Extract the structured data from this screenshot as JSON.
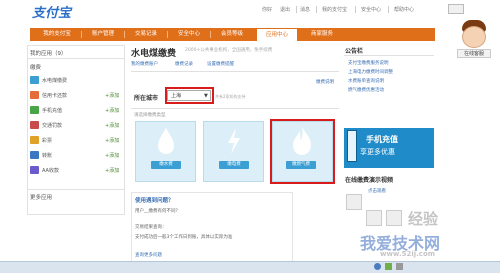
{
  "header": {
    "logo": "支付宝",
    "top_links": [
      "你好",
      "退出",
      "消息",
      "我的支付宝",
      "安全中心",
      "帮助中心"
    ],
    "nav": [
      "我的支付宝",
      "账户管理",
      "交易记录",
      "安全中心",
      "会员等级",
      "应用中心",
      "商家服务"
    ]
  },
  "assistant": {
    "label": "在线客服"
  },
  "sidebar": {
    "my_apps": "我的应用（9）",
    "section": "缴费",
    "items": [
      {
        "label": "水电煤缴费",
        "add": ""
      },
      {
        "label": "信用卡还款",
        "add": "+添加"
      },
      {
        "label": "手机充值",
        "add": "+添加"
      },
      {
        "label": "交通罚款",
        "add": "+添加"
      },
      {
        "label": "彩票",
        "add": "+添加"
      },
      {
        "label": "转账",
        "add": "+添加"
      },
      {
        "label": "AA收款",
        "add": "+添加"
      }
    ],
    "more": "更多应用"
  },
  "main": {
    "title": "水电煤缴费",
    "subtitle": "2000+公共事业机构，全国通用，免手续费",
    "links": [
      "我的缴费账户",
      "缴费记录",
      "设置缴费提醒"
    ],
    "right_link": "缴费说明",
    "city_label": "所在城市",
    "city_value": "上海",
    "city_note": "共有2家机构支持",
    "hint": "请选择缴费类型",
    "tiles": [
      {
        "icon": "water-drop-icon",
        "label": "缴水费"
      },
      {
        "icon": "lightning-icon",
        "label": "缴电费"
      },
      {
        "icon": "flame-icon",
        "label": "缴燃气费"
      }
    ],
    "faq_title": "使用遇到问题？",
    "faq_lines": [
      "用户__缴费有何不同？",
      "交易结果查询：",
      "支付成功后一般3个工作日到账，具体以实际为准",
      "查询更多问题"
    ]
  },
  "right": {
    "notice_title": "公告栏",
    "notices": [
      "支付宝缴费服务说明",
      "上海电力缴费时间调整",
      "水费账单查询说明",
      "燃气缴费优惠活动"
    ],
    "banner_line1": "手机充值",
    "banner_line2": "享更多优惠",
    "guide_title": "在线缴费演示视频",
    "guide_sub": "点击观看"
  },
  "watermarks": [
    "经验",
    "我爱技术网",
    "www.52ij.com"
  ],
  "colors": {
    "brand_orange": "#e06f1a",
    "tile_blue": "#3b9fd4",
    "highlight_red": "#d81b1b"
  }
}
